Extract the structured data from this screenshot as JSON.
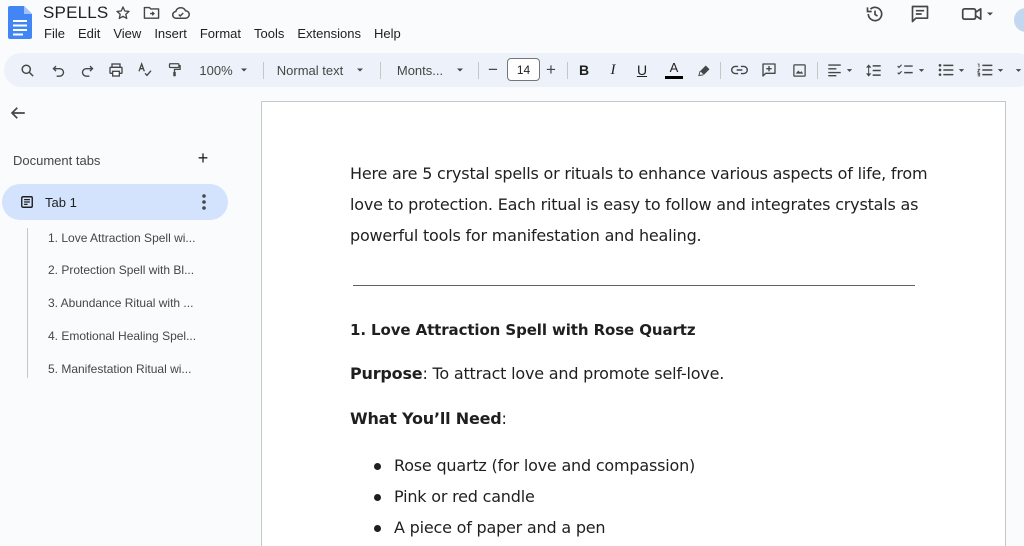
{
  "app": {
    "title": "SPELLS",
    "menu": [
      "File",
      "Edit",
      "View",
      "Insert",
      "Format",
      "Tools",
      "Extensions",
      "Help"
    ]
  },
  "toolbar": {
    "zoom": "100%",
    "style": "Normal text",
    "font": "Monts...",
    "font_size": "14",
    "minus": "−",
    "plus": "+",
    "bold": "B",
    "italic": "I",
    "underline": "U",
    "text_color": "A"
  },
  "sidebar": {
    "tabs_header": "Document tabs",
    "add_symbol": "+",
    "active_tab": "Tab 1",
    "outline": [
      "1. Love Attraction Spell wi...",
      "2. Protection Spell with Bl...",
      "3. Abundance Ritual with ...",
      "4. Emotional Healing Spel...",
      "5. Manifestation Ritual wi..."
    ]
  },
  "document": {
    "intro": "Here are 5 crystal spells or rituals to enhance various aspects of life, from love to protection. Each ritual is easy to follow and integrates crystals as powerful tools for manifestation and healing.",
    "heading1": "1. Love Attraction Spell with Rose Quartz",
    "purpose_label": "Purpose",
    "purpose_text": ": To attract love and promote self-love.",
    "need_label": "What You’ll Need",
    "need_colon": ":",
    "bullets": [
      "Rose quartz (for love and compassion)",
      "Pink or red candle",
      "A piece of paper and a pen"
    ]
  },
  "colors": {
    "accent": "#d3e3fd",
    "toolbar_bg": "#edf2fa",
    "docs_blue": "#4285f4"
  }
}
